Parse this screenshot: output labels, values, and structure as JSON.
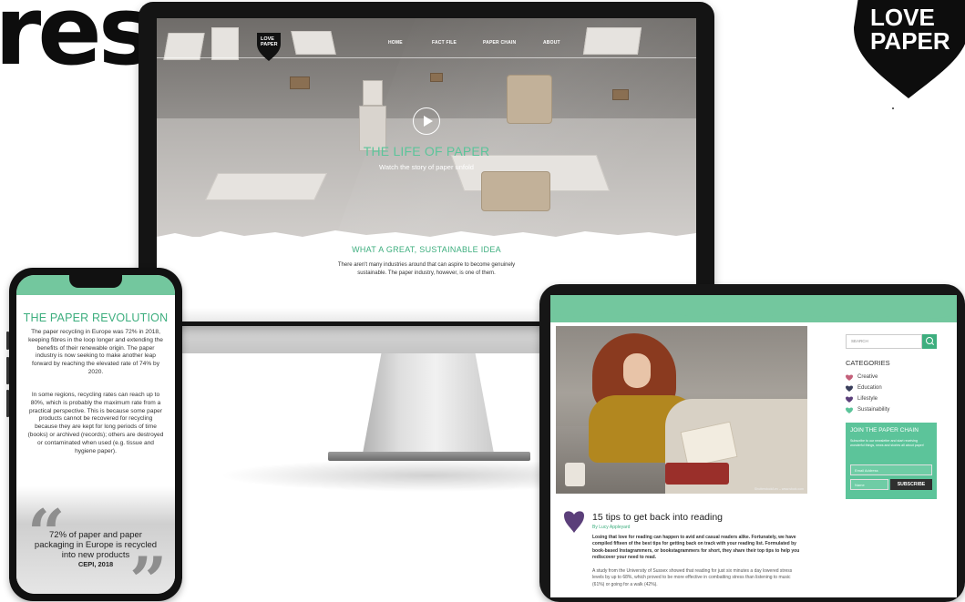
{
  "heading": {
    "text": "res"
  },
  "corner_logo": {
    "line1": "LOVE",
    "line2": "PAPER"
  },
  "desktop": {
    "logo": {
      "line1": "LOVE",
      "line2": "PAPER"
    },
    "nav": [
      "HOME",
      "FACT FILE",
      "PAPER CHAIN",
      "ABOUT"
    ],
    "hero_title": "THE LIFE OF PAPER",
    "hero_subtitle": "Watch the story of paper unfold",
    "section_title": "WHAT A GREAT, SUSTAINABLE IDEA",
    "section_body": "There aren't many industries around that can aspire to become genuinely sustainable. The paper industry, however, is one of them."
  },
  "phone": {
    "title": "THE PAPER REVOLUTION",
    "paragraph1": "The paper recycling in Europe was 72% in 2018, keeping fibres in the loop longer and extending the benefits of their renewable origin. The paper industry is now seeking to make another leap forward by reaching the elevated rate of 74% by 2020.",
    "paragraph2": "In some regions, recycling rates can reach up to 80%, which is probably the maximum rate from a practical perspective. This is because some paper products cannot be recovered for recycling because they are kept for long periods of time (books) or archived (records); others are destroyed or contaminated when used (e.g. tissue and hygiene paper).",
    "quote": "72% of paper and paper packaging in Europe is recycled into new products",
    "quote_source": "CEPI, 2018"
  },
  "tablet": {
    "photo_credit": "Shutterstock/Lev – www.stock.com",
    "post_title": "15 tips to get back into reading",
    "post_author": "By Lucy Appleyard",
    "post_lead": "Losing that love for reading can happen to avid and casual readers alike. Fortunately, we have compiled fifteen of the best tips for getting back on track with your reading list. Formulated by book-based Instagrammers, or bookstagrammers for short, they share their top tips to help you rediscover your need to read.",
    "post_body": "A study from the University of Sussex showed that reading for just six minutes a day lowered stress levels by up to 68%, which proved to be more effective in combatting stress than listening to music (61%) or going for a walk (42%).",
    "search_placeholder": "SEARCH",
    "categories_title": "CATEGORIES",
    "categories": [
      {
        "label": "Creative",
        "color": "#c4607a"
      },
      {
        "label": "Education",
        "color": "#3a3f5c"
      },
      {
        "label": "Lifestyle",
        "color": "#5b3f7a"
      },
      {
        "label": "Sustainability",
        "color": "#5cc49a"
      }
    ],
    "join_title": "JOIN THE PAPER CHAIN",
    "join_text": "Subscribe to our newsletter and start receiving wonderful things, news and stories all about paper!",
    "email_placeholder": "Email Address",
    "name_placeholder": "Name",
    "subscribe_label": "SUBSCRIBE"
  },
  "colors": {
    "brand_green": "#5cc49a",
    "dark": "#111111"
  }
}
